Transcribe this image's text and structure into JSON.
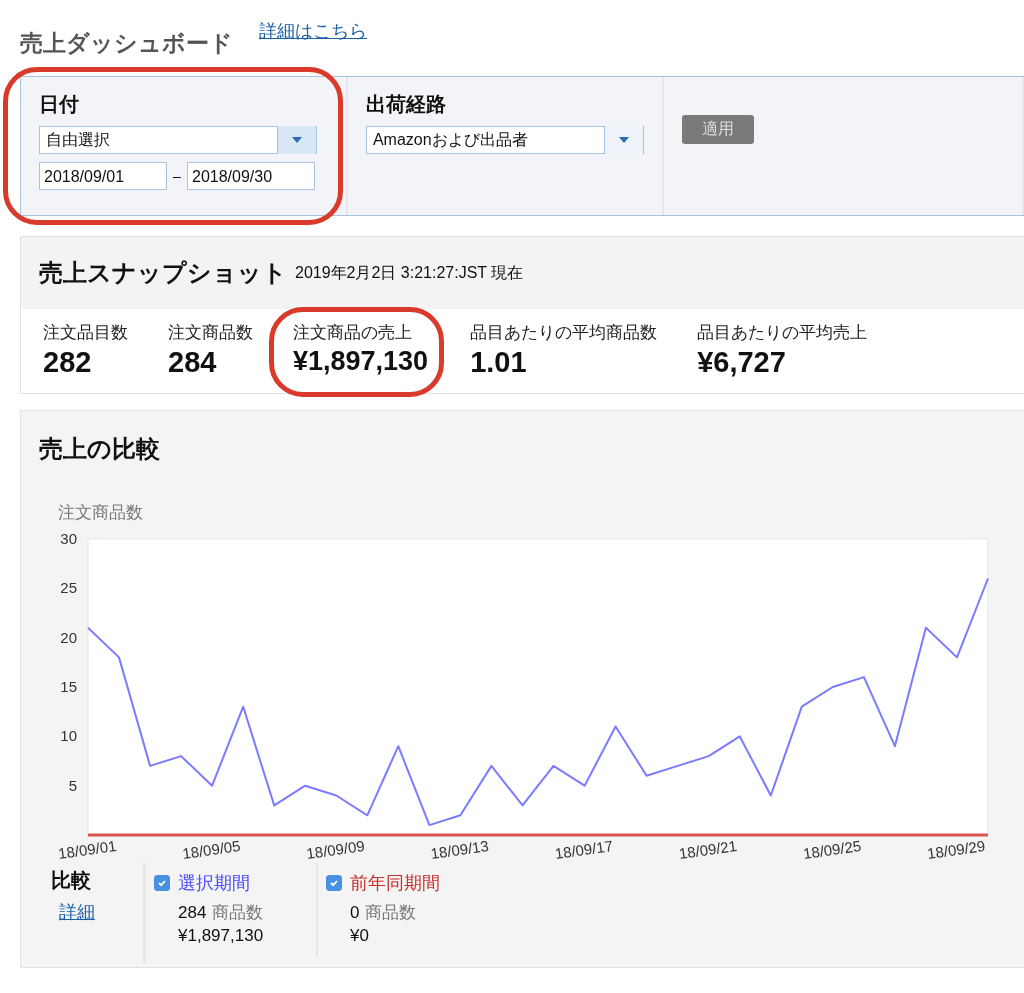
{
  "header": {
    "title": "売上ダッシュボード",
    "link": "詳細はこちら"
  },
  "filters": {
    "date": {
      "label": "日付",
      "select": "自由選択",
      "from": "2018/09/01",
      "separator": "–",
      "to": "2018/09/30",
      "highlighted": true
    },
    "channel": {
      "label": "出荷経路",
      "select": "Amazonおよび出品者"
    },
    "apply_button": {
      "label": "適用",
      "disabled": true
    }
  },
  "snapshot": {
    "title": "売上スナップショット",
    "timestamp": "2019年2月2日 3:21:27:JST 現在",
    "metrics": [
      {
        "label": "注文品目数",
        "value": "282"
      },
      {
        "label": "注文商品数",
        "value": "284"
      },
      {
        "label": "注文商品の売上",
        "value": "¥1,897,130",
        "highlighted": true
      },
      {
        "label": "品目あたりの平均商品数",
        "value": "1.01"
      },
      {
        "label": "品目あたりの平均売上",
        "value": "¥6,727"
      }
    ]
  },
  "comparison": {
    "title": "売上の比較",
    "chart_data": {
      "type": "line",
      "ylabel": "注文商品数",
      "ylim": [
        0,
        30
      ],
      "yticks": [
        5,
        10,
        15,
        20,
        25,
        30
      ],
      "categories": [
        "18/09/01",
        null,
        null,
        null,
        "18/09/05",
        null,
        null,
        null,
        "18/09/09",
        null,
        null,
        null,
        "18/09/13",
        null,
        null,
        null,
        "18/09/17",
        null,
        null,
        null,
        "18/09/21",
        null,
        null,
        null,
        "18/09/25",
        null,
        null,
        null,
        "18/09/29",
        null
      ],
      "series": [
        {
          "name": "選択期間",
          "color": "#7b7bff",
          "values": [
            21,
            18,
            7,
            8,
            5,
            13,
            3,
            5,
            4,
            2,
            9,
            1,
            2,
            7,
            3,
            7,
            5,
            11,
            6,
            7,
            8,
            10,
            4,
            13,
            15,
            16,
            9,
            21,
            18,
            26
          ]
        },
        {
          "name": "前年同期間",
          "color": "#d9534f",
          "values": [
            0,
            0,
            0,
            0,
            0,
            0,
            0,
            0,
            0,
            0,
            0,
            0,
            0,
            0,
            0,
            0,
            0,
            0,
            0,
            0,
            0,
            0,
            0,
            0,
            0,
            0,
            0,
            0,
            0,
            0
          ]
        }
      ]
    },
    "legend": {
      "label": "比較",
      "link": "詳細",
      "items": [
        {
          "checked": true,
          "color": "#4a4aff",
          "count": "284",
          "unit": "商品数",
          "sales": "¥1,897,130"
        },
        {
          "checked": true,
          "color": "#c9302c",
          "count": "0",
          "unit": "商品数",
          "sales": "¥0"
        }
      ]
    }
  }
}
